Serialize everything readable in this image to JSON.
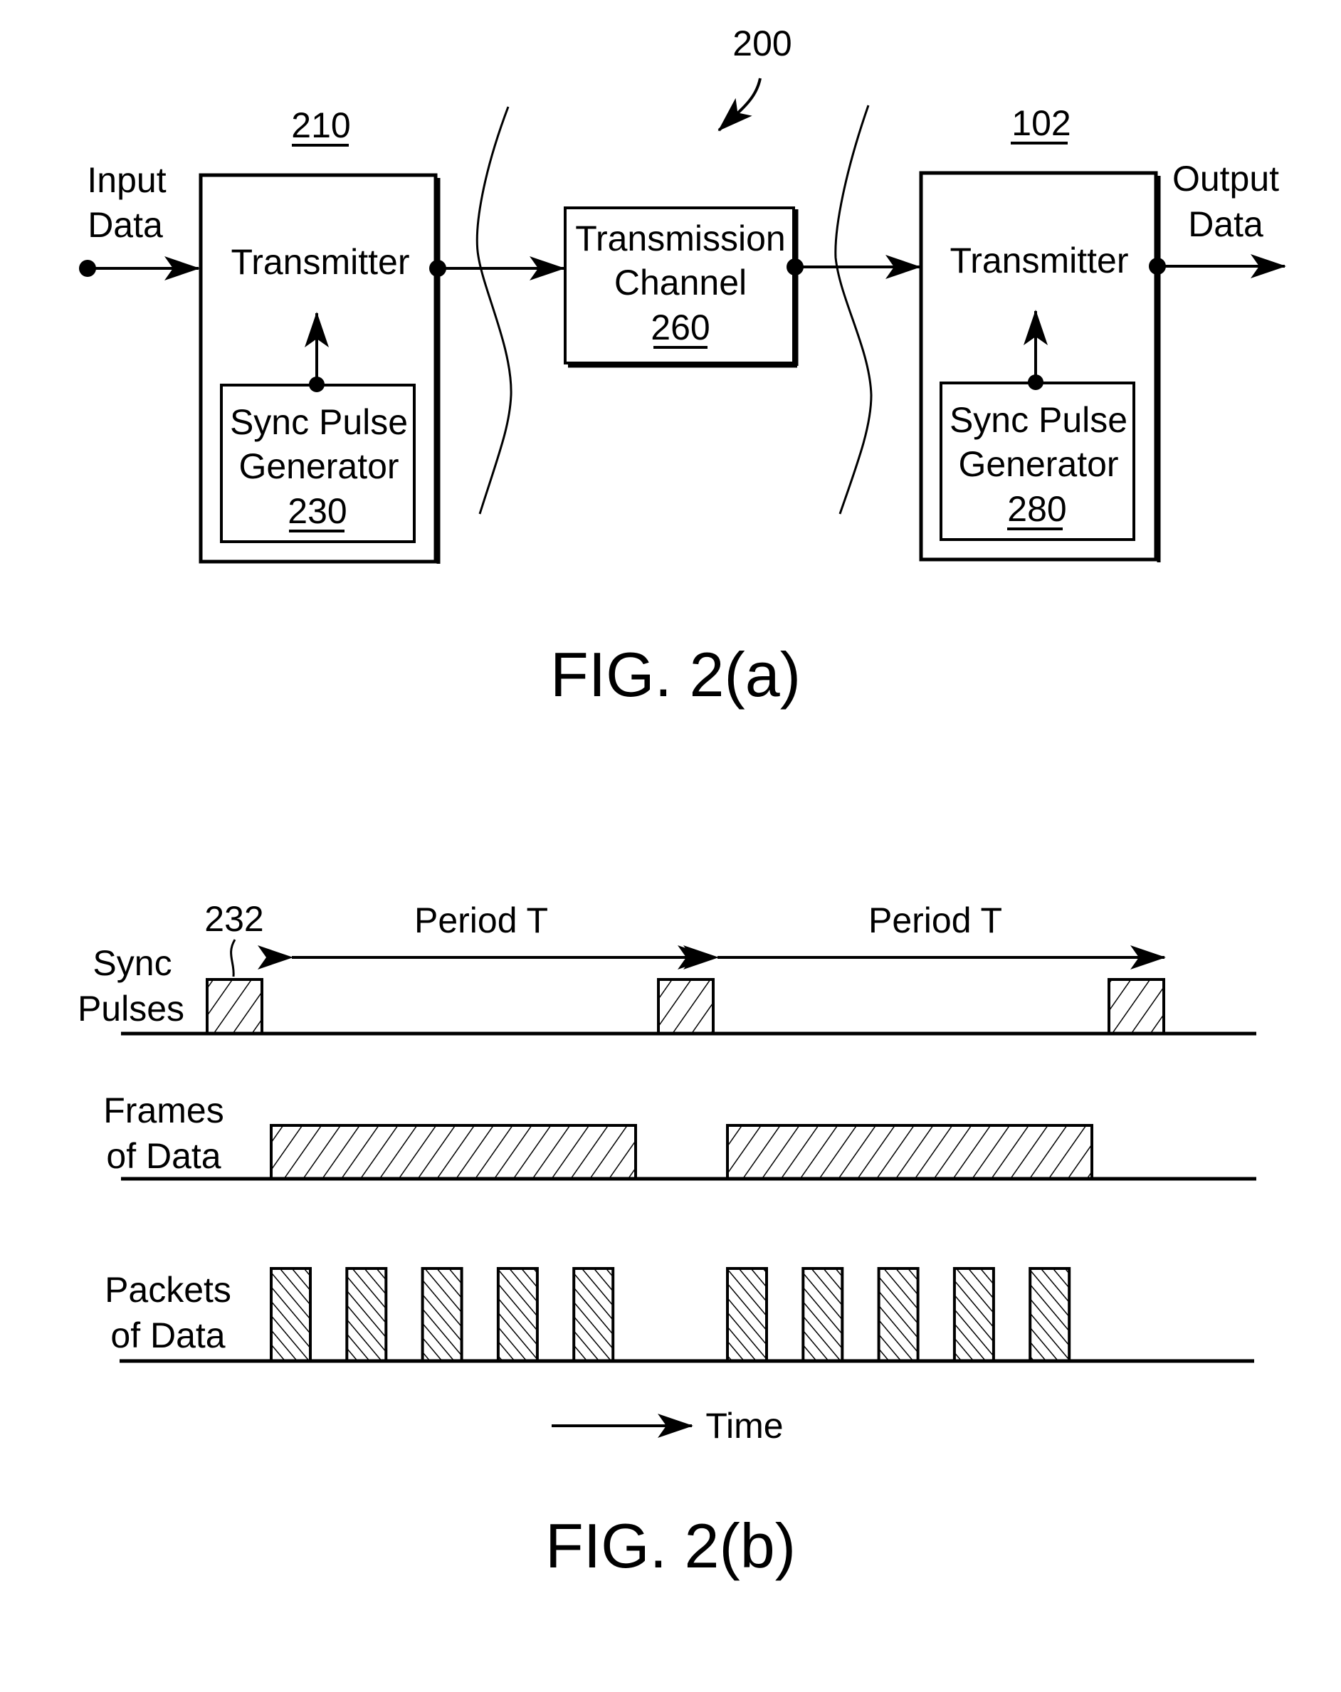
{
  "figure_a": {
    "system_ref": "200",
    "input_label_1": "Input",
    "input_label_2": "Data",
    "output_label_1": "Output",
    "output_label_2": "Data",
    "tx1": {
      "ref": "210",
      "label": "Transmitter",
      "gen_line1": "Sync Pulse",
      "gen_line2": "Generator",
      "gen_ref": "230"
    },
    "channel": {
      "line1": "Transmission",
      "line2": "Channel",
      "ref": "260"
    },
    "tx2": {
      "ref": "102",
      "label": "Transmitter",
      "gen_line1": "Sync Pulse",
      "gen_line2": "Generator",
      "gen_ref": "280"
    },
    "caption": "FIG. 2(a)"
  },
  "figure_b": {
    "pulse_ref": "232",
    "period_label_1": "Period T",
    "period_label_2": "Period T",
    "row1_line1": "Sync",
    "row1_line2": "Pulses",
    "row2_line1": "Frames",
    "row2_line2": "of Data",
    "row3_line1": "Packets",
    "row3_line2": "of Data",
    "time_label": "Time",
    "caption": "FIG. 2(b)",
    "sync_pulse_count": 3,
    "frames_count": 2,
    "packets_per_frame": 5
  }
}
